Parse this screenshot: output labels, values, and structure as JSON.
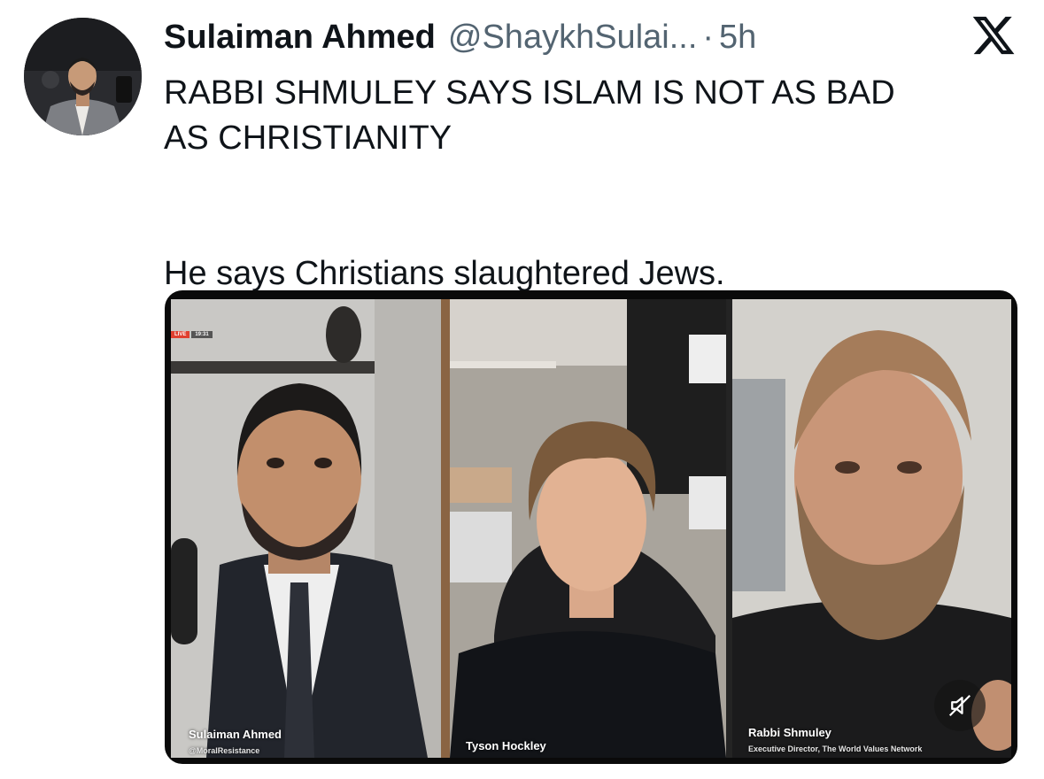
{
  "post": {
    "author_name": "Sulaiman Ahmed",
    "author_handle": "@ShaykhSulai...",
    "time_separator": "·",
    "timestamp": "5h",
    "line1": "RABBI SHMULEY SAYS ISLAM IS NOT AS BAD",
    "line2": "AS CHRISTIANITY",
    "line3": "He says Christians slaughtered Jews."
  },
  "icons": {
    "brand": "x-logo-icon",
    "avatar": "profile-photo",
    "mute": "muted-speaker-icon"
  },
  "video": {
    "live_badge": "LIVE",
    "live_time": "19:31",
    "panels": [
      {
        "name": "Sulaiman Ahmed",
        "subtitle": "@MoralResistance"
      },
      {
        "name": "Tyson Hockley",
        "subtitle": ""
      },
      {
        "name": "Rabbi Shmuley",
        "subtitle": "Executive Director, The World Values Network"
      }
    ]
  },
  "colors": {
    "text_primary": "#0f1419",
    "text_secondary": "#536471",
    "background": "#ffffff"
  }
}
